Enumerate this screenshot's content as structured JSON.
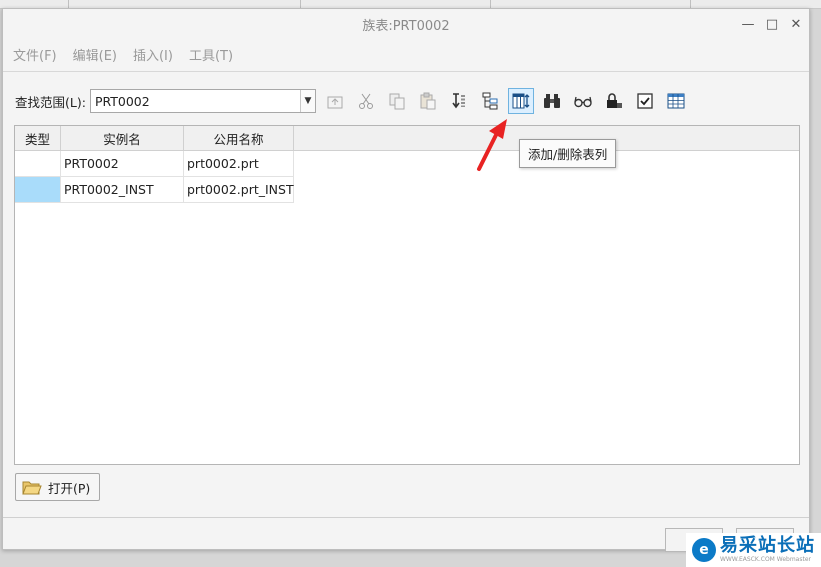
{
  "window": {
    "title": "族表:PRT0002",
    "controls": [
      "—",
      "□",
      "✕"
    ]
  },
  "menu": [
    "文件(F)",
    "编辑(E)",
    "插入(I)",
    "工具(T)"
  ],
  "toolbar": {
    "lookin_label": "查找范围(L):",
    "lookin_value": "PRT0002",
    "tools": [
      "up-level-icon",
      "cut-icon",
      "copy-icon",
      "paste-icon",
      "sort-icon",
      "tree-icon",
      "add-remove-columns-icon",
      "binoculars-icon",
      "glasses-icon",
      "lock-icon",
      "checkbox-icon",
      "table-icon"
    ]
  },
  "tooltip": "添加/删除表列",
  "table": {
    "headers": [
      "类型",
      "实例名",
      "公用名称"
    ],
    "rows": [
      {
        "type": "",
        "instance": "PRT0002",
        "common": "prt0002.prt"
      },
      {
        "type": "",
        "instance": "PRT0002_INST",
        "common": "prt0002.prt_INST"
      }
    ]
  },
  "open_button": "打开(P)",
  "watermark": {
    "brand": "易采站长站",
    "sub": "WWW.EASCK.COM Webmaster"
  },
  "colors": {
    "selection": "#a9dcfa",
    "annotation_arrow": "#e82323",
    "tool_active_border": "#6fb3e0"
  }
}
